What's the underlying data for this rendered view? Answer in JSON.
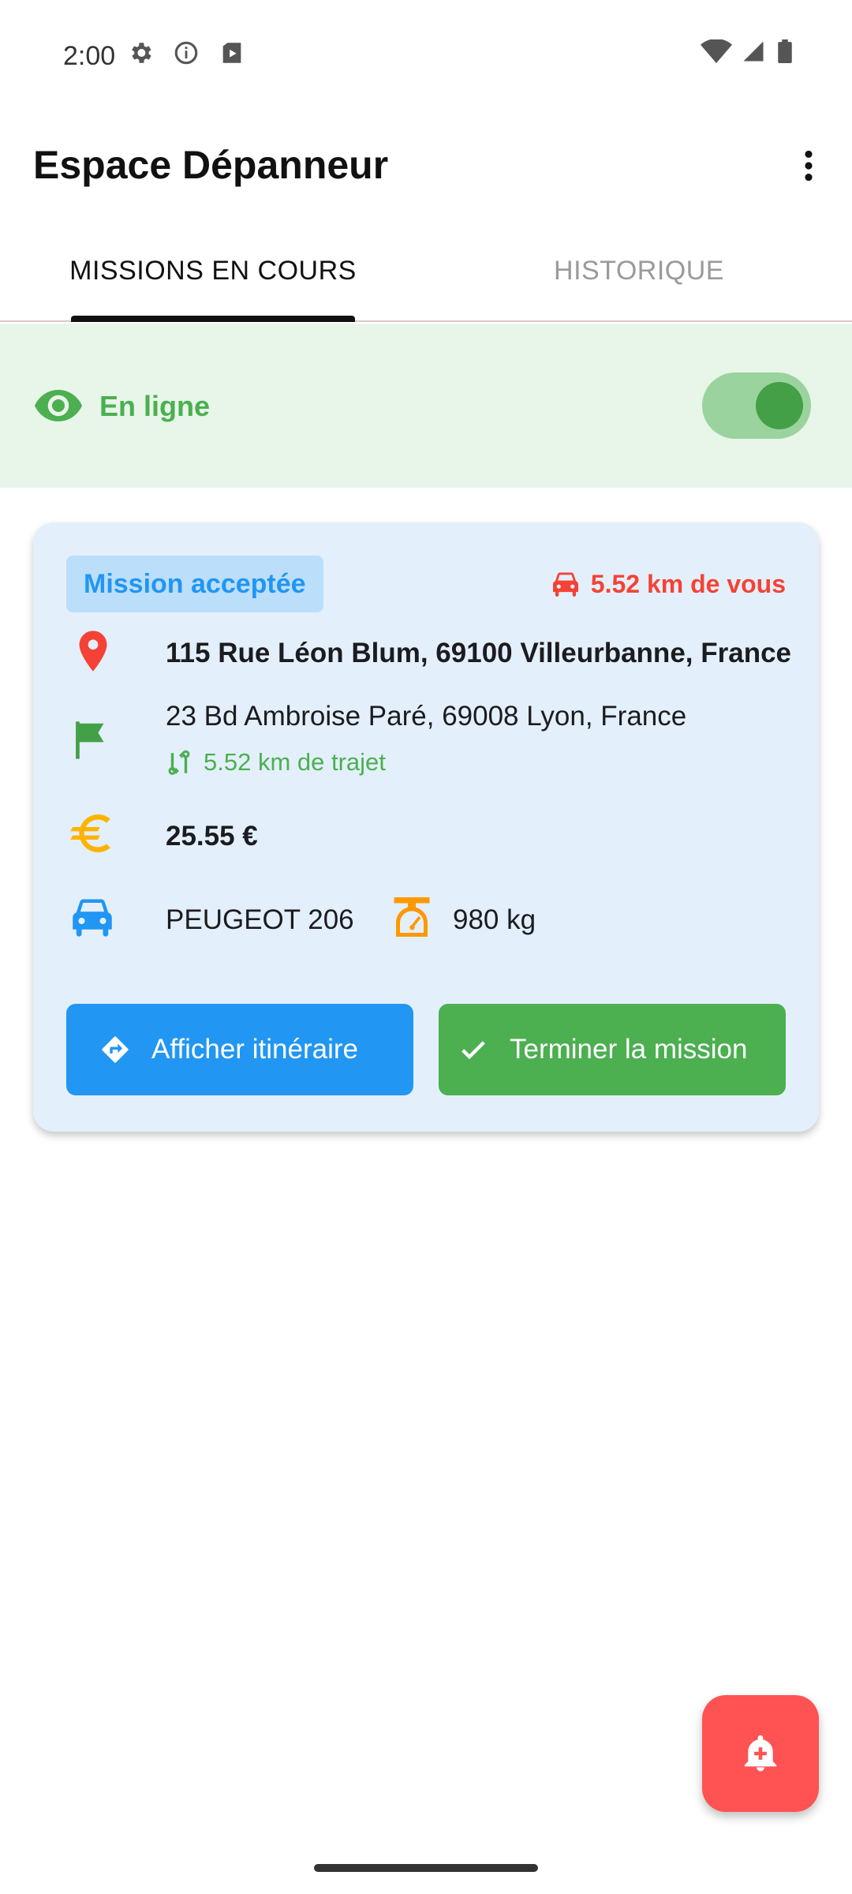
{
  "status_bar": {
    "time": "2:00",
    "icons": [
      "settings-gear-icon",
      "info-icon",
      "play-store-icon",
      "wifi-icon",
      "signal-icon",
      "battery-icon"
    ]
  },
  "app_bar": {
    "title": "Espace Dépanneur",
    "menu_icon": "more-vert-icon"
  },
  "tabs": [
    {
      "label": "MISSIONS EN COURS",
      "selected": true
    },
    {
      "label": "HISTORIQUE",
      "selected": false
    }
  ],
  "availability": {
    "label": "En ligne",
    "icon": "eye-icon",
    "toggle_on": true,
    "colors": {
      "background": "#e8f5e9",
      "accent": "#4caf50"
    }
  },
  "mission": {
    "status_badge": "Mission acceptée",
    "distance_to_you": "5.52 km de vous",
    "pickup_address": "115 Rue Léon Blum, 69100 Villeurbanne, France",
    "destination_address": "23 Bd Ambroise Paré, 69008 Lyon, France",
    "trip_distance": "5.52 km de trajet",
    "price": "25.55 €",
    "vehicle_model": "PEUGEOT 206",
    "vehicle_weight": "980 kg",
    "route_button_label": "Afficher itinéraire",
    "finish_button_label": "Terminer la mission",
    "colors": {
      "card": "#e3f0fb",
      "badge_bg": "#bbdefb",
      "primary": "#2196f3",
      "success": "#4caf50",
      "danger": "#f44336",
      "money": "#ffb300",
      "weight": "#ff9800"
    }
  },
  "fab": {
    "icon": "notification-add-icon",
    "color": "#ff5252"
  }
}
